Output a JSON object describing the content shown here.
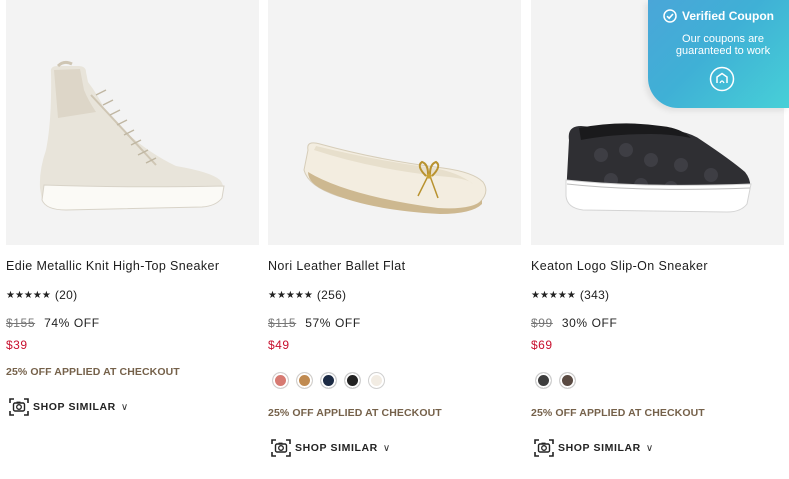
{
  "products": [
    {
      "title": "Edie Metallic Knit High-Top Sneaker",
      "stars": "★★★★★",
      "rating": 4.5,
      "reviews": "(20)",
      "original_price": "$155",
      "discount": "74% OFF",
      "sale_price": "$39",
      "swatches": [],
      "promo": "25% OFF APPLIED AT CHECKOUT",
      "shop_similar": "SHOP SIMILAR"
    },
    {
      "title": "Nori Leather Ballet Flat",
      "stars": "★★★★★",
      "rating": 4.5,
      "reviews": "(256)",
      "original_price": "$115",
      "discount": "57% OFF",
      "sale_price": "$49",
      "swatches": [
        "#d77a72",
        "#c08a50",
        "#1c2b45",
        "#222222",
        "#f2ece3"
      ],
      "promo": "25% OFF APPLIED AT CHECKOUT",
      "shop_similar": "SHOP SIMILAR"
    },
    {
      "title": "Keaton Logo Slip-On Sneaker",
      "stars": "★★★★★",
      "rating": 4.5,
      "reviews": "(343)",
      "original_price": "$99",
      "discount": "30% OFF",
      "sale_price": "$69",
      "swatches": [
        "#3d3d3d",
        "#5a4a42"
      ],
      "promo": "25% OFF APPLIED AT CHECKOUT",
      "shop_similar": "SHOP SIMILAR"
    }
  ],
  "coupon": {
    "title": "Verified Coupon",
    "text": "Our coupons are guaranteed to work"
  },
  "colors": {
    "sale": "#c8102e",
    "promo": "#75614a",
    "coupon_start": "#4aa6d8",
    "coupon_end": "#47d0d7"
  }
}
